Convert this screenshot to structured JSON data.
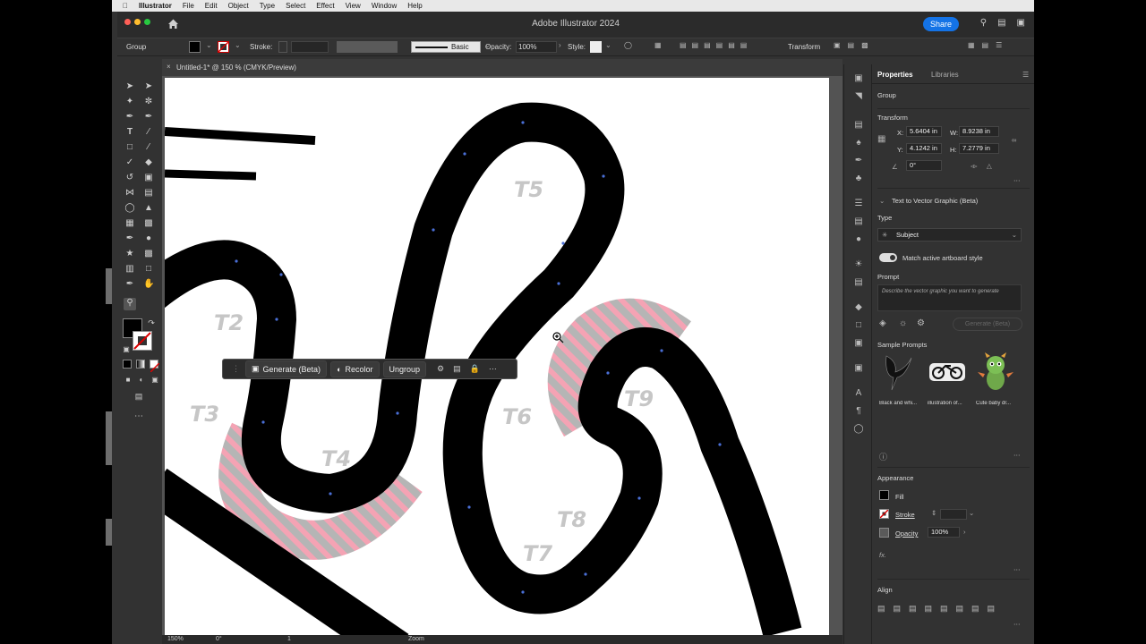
{
  "menubar": {
    "app": "Illustrator",
    "items": [
      "File",
      "Edit",
      "Object",
      "Type",
      "Select",
      "Effect",
      "View",
      "Window",
      "Help"
    ]
  },
  "titlebar": {
    "title": "Adobe Illustrator 2024",
    "share": "Share"
  },
  "controlbar": {
    "selection": "Group",
    "stroke_label": "Stroke:",
    "brush": "Basic",
    "opacity_label": "Opacity:",
    "opacity_value": "100%",
    "style_label": "Style:",
    "transform": "Transform"
  },
  "document": {
    "tab": "Untitled-1* @ 150 % (CMYK/Preview)"
  },
  "canvas": {
    "labels": [
      "T2",
      "T3",
      "T4",
      "T5",
      "T6",
      "T7",
      "T8",
      "T9"
    ]
  },
  "context_bar": {
    "generate": "Generate (Beta)",
    "recolor": "Recolor",
    "ungroup": "Ungroup"
  },
  "statusbar": {
    "zoom": "150%",
    "rotation": "0°",
    "artboard": "1",
    "mode": "Zoom"
  },
  "panel": {
    "tabs": [
      "Properties",
      "Libraries"
    ],
    "selection": "Group",
    "transform": {
      "title": "Transform",
      "x_label": "X:",
      "x": "5.6404 in",
      "y_label": "Y:",
      "y": "4.1242 in",
      "w_label": "W:",
      "w": "8.9238 in",
      "h_label": "H:",
      "h": "7.2779 in",
      "angle": "0°"
    },
    "text_to_vector": {
      "title": "Text to Vector Graphic (Beta)",
      "type_label": "Type",
      "type_value": "Subject",
      "match_label": "Match active artboard style",
      "prompt_label": "Prompt",
      "prompt_placeholder": "Describe the vector graphic you want to generate",
      "generate": "Generate (Beta)",
      "samples_label": "Sample Prompts",
      "samples": [
        "Black and whi...",
        "illustration of...",
        "Cute baby dr..."
      ]
    },
    "appearance": {
      "title": "Appearance",
      "fill": "Fill",
      "stroke": "Stroke",
      "opacity_label": "Opacity",
      "opacity_value": "100%",
      "fx": "fx."
    },
    "align": {
      "title": "Align"
    }
  },
  "colors": {
    "accent": "#1473e6",
    "ui_dark": "#323232",
    "track": "#000000",
    "hatch_pink": "#f4a3b4",
    "hatch_gray": "#b5b5b5",
    "label_gray": "#c6c6c6"
  }
}
